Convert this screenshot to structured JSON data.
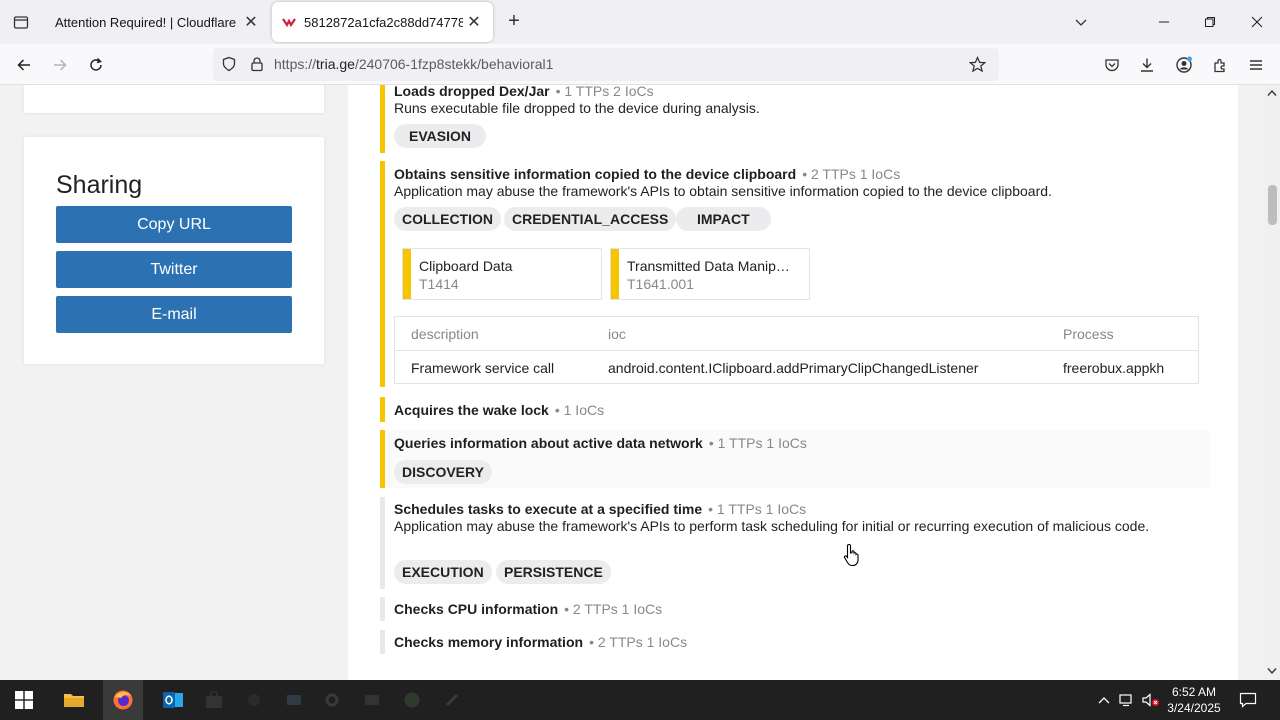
{
  "browser": {
    "tabs": [
      {
        "title": "Attention Required! | Cloudflare"
      },
      {
        "title": "5812872a1cfa2c88dd7477881e…"
      }
    ],
    "url": {
      "scheme": "https://",
      "host": "tria.ge",
      "path": "/240706-1fzp8stekk/behavioral1"
    }
  },
  "sidebar": {
    "sharing_title": "Sharing",
    "buttons": [
      "Copy URL",
      "Twitter",
      "E-mail"
    ]
  },
  "signatures": [
    {
      "name": "Loads dropped Dex/Jar",
      "meta": "• 1 TTPs 2 IoCs",
      "description": "Runs executable file dropped to the device during analysis.",
      "tags": [
        "EVASION"
      ]
    },
    {
      "name": "Obtains sensitive information copied to the device clipboard",
      "meta": "• 2 TTPs 1 IoCs",
      "description": "Application may abuse the framework's APIs to obtain sensitive information copied to the device clipboard.",
      "tags": [
        "COLLECTION",
        "CREDENTIAL_ACCESS",
        "IMPACT"
      ],
      "ttps": [
        {
          "name": "Clipboard Data",
          "id": "T1414"
        },
        {
          "name": "Transmitted Data Manip…",
          "id": "T1641.001"
        }
      ],
      "ioc_table": {
        "headers": [
          "description",
          "ioc",
          "Process"
        ],
        "rows": [
          [
            "Framework service call",
            "android.content.IClipboard.addPrimaryClipChangedListener",
            "freerobux.appkh"
          ]
        ]
      }
    },
    {
      "name": "Acquires the wake lock",
      "meta": "• 1 IoCs"
    },
    {
      "name": "Queries information about active data network",
      "meta": "• 1 TTPs 1 IoCs",
      "tags": [
        "DISCOVERY"
      ]
    },
    {
      "name": "Schedules tasks to execute at a specified time",
      "meta": "• 1 TTPs 1 IoCs",
      "description": "Application may abuse the framework's APIs to perform task scheduling for initial or recurring execution of malicious code.",
      "tags": [
        "EXECUTION",
        "PERSISTENCE"
      ]
    },
    {
      "name": "Checks CPU information",
      "meta": "• 2 TTPs 1 IoCs"
    },
    {
      "name": "Checks memory information",
      "meta": "• 2 TTPs 1 IoCs"
    }
  ],
  "taskbar": {
    "time": "6:52 AM",
    "date": "3/24/2025"
  },
  "colors": {
    "highlight": "#f6c500",
    "button": "#2c72b3"
  }
}
